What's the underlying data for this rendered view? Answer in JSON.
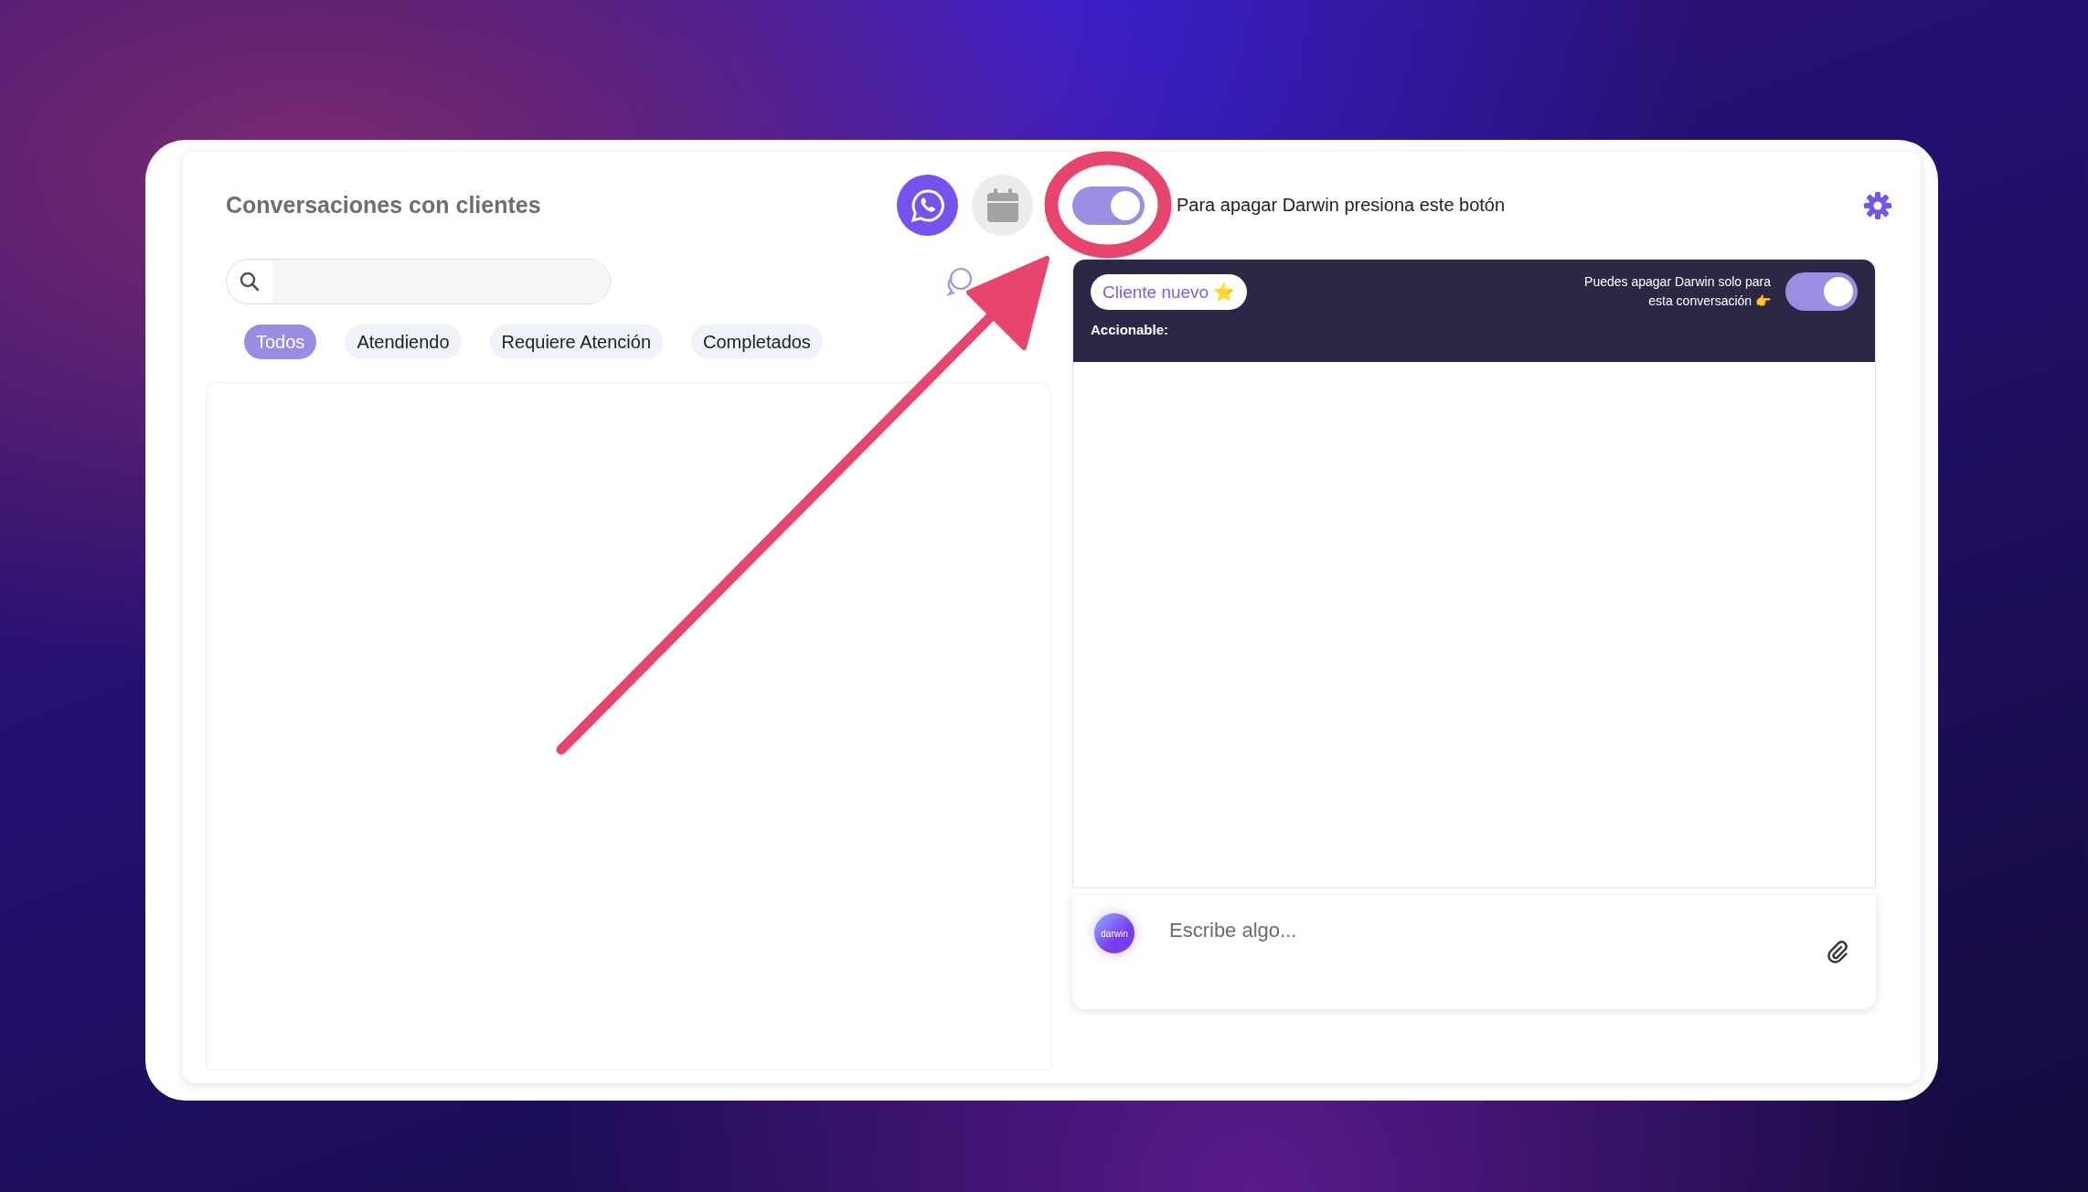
{
  "header": {
    "title": "Conversaciones con clientes",
    "bot_toggle": {
      "on": true
    },
    "hint": "Para apagar Darwin presiona este botón"
  },
  "filters": [
    {
      "label": "Todos",
      "selected": true
    },
    {
      "label": "Atendiendo",
      "selected": false
    },
    {
      "label": "Requiere Atención",
      "selected": false
    },
    {
      "label": "Completados",
      "selected": false
    }
  ],
  "conversation": {
    "tag": "Cliente nuevo ⭐",
    "toggle_hint": "Puedes apagar Darwin solo para esta conversación 👉",
    "toggle": {
      "on": true
    },
    "actionable_label": "Accionable:"
  },
  "composer": {
    "avatar_text": "darwin",
    "placeholder": "Escribe algo..."
  }
}
